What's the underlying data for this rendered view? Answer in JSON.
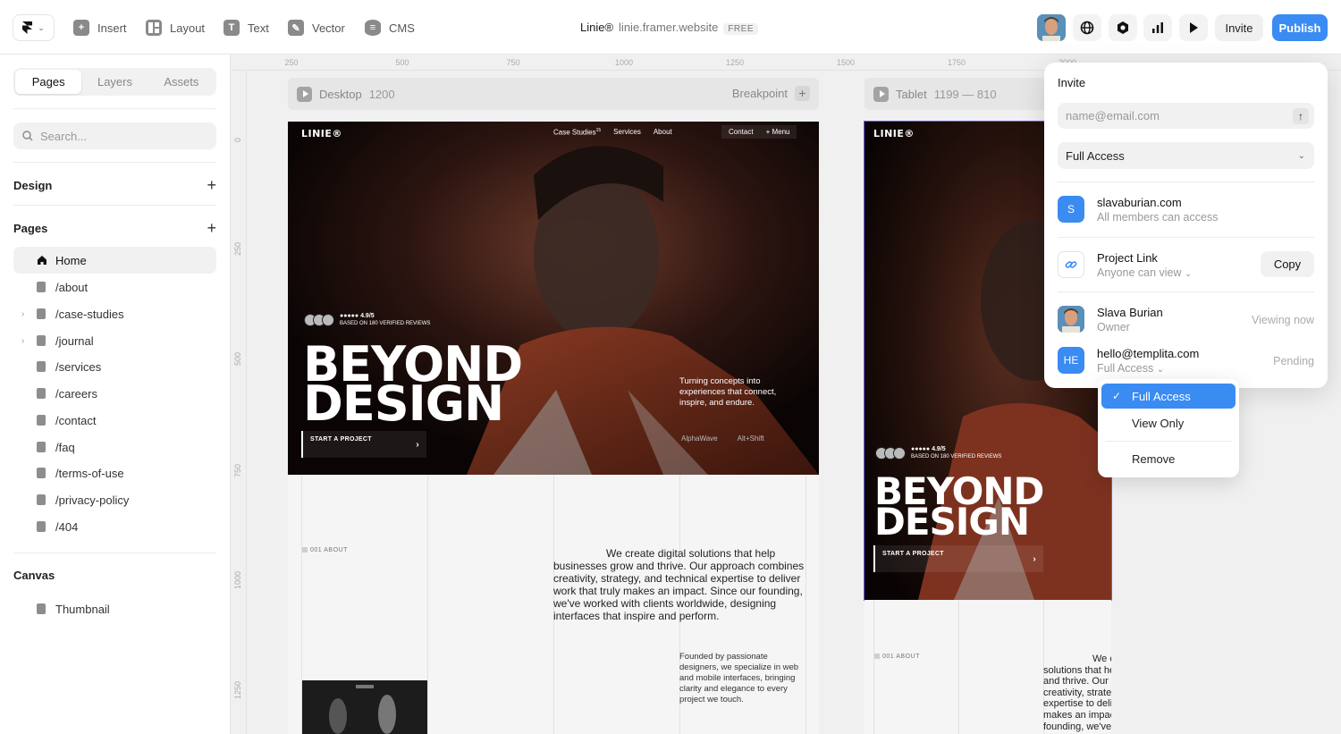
{
  "topbar": {
    "insert": "Insert",
    "layout": "Layout",
    "text": "Text",
    "vector": "Vector",
    "cms": "CMS",
    "project_name": "Linie®",
    "project_url": "linie.framer.website",
    "plan_badge": "FREE",
    "invite": "Invite",
    "publish": "Publish"
  },
  "sidebar": {
    "tabs": [
      "Pages",
      "Layers",
      "Assets"
    ],
    "search_placeholder": "Search...",
    "design_header": "Design",
    "pages_header": "Pages",
    "pages": [
      "Home",
      "/about",
      "/case-studies",
      "/journal",
      "/services",
      "/careers",
      "/contact",
      "/faq",
      "/terms-of-use",
      "/privacy-policy",
      "/404"
    ],
    "canvas_header": "Canvas",
    "canvas_items": [
      "Thumbnail"
    ]
  },
  "rulers": {
    "top": [
      "250",
      "500",
      "750",
      "1000",
      "1250",
      "1500",
      "1750",
      "2000"
    ],
    "left": [
      "0",
      "250",
      "500",
      "750",
      "1000",
      "1250"
    ]
  },
  "breakpoints": {
    "desktop": {
      "name": "Desktop",
      "width": "1200",
      "action": "Breakpoint"
    },
    "tablet": {
      "name": "Tablet",
      "range": "1199 — 810"
    }
  },
  "site": {
    "logo": "LINIE®",
    "nav": [
      "Case Studies",
      "Services",
      "About"
    ],
    "nav_sup": "15",
    "contact": "Contact",
    "menu": "+ Menu",
    "rating": "●●●●● 4.9/5",
    "reviews": "BASED ON 180 VERIFIED REVIEWS",
    "headline_1": "BEYOND",
    "headline_2": "DESIGN",
    "cta": "START A PROJECT",
    "tagline": "Turning concepts into experiences that connect, inspire, and endure.",
    "brands": [
      "AlphaWave",
      "Alt+Shift"
    ],
    "about_tag": "001   ABOUT",
    "about_text": "We create digital solutions that help businesses grow and thrive. Our approach combines creativity, strategy, and technical expertise to deliver work that truly makes an impact. Since our founding, we've worked with clients worldwide, designing interfaces that inspire and perform.",
    "about_small": "Founded by passionate designers, we specialize in web and mobile interfaces, bringing clarity and elegance to every project we touch.",
    "tablet_about_text": "We create digital solutions that help businesses grow and thrive. Our approach combines creativity, strategy, and technical expertise to deliver work that truly makes an impact. Since our founding, we've worked with clients"
  },
  "invite_popover": {
    "title": "Invite",
    "email_placeholder": "name@email.com",
    "access_select": "Full Access",
    "workspace": {
      "initial": "S",
      "name": "slavaburian.com",
      "desc": "All members can access"
    },
    "project_link": {
      "title": "Project Link",
      "desc": "Anyone can view",
      "copy": "Copy"
    },
    "members": [
      {
        "name": "Slava Burian",
        "role": "Owner",
        "status": "Viewing now"
      },
      {
        "initial": "HE",
        "name": "hello@templita.com",
        "role": "Full Access",
        "status": "Pending"
      }
    ]
  },
  "access_menu": {
    "options": [
      "Full Access",
      "View Only"
    ],
    "remove": "Remove",
    "selected": "Full Access"
  },
  "colors": {
    "accent": "#3a8bf2",
    "workspace_icon": "#3a8bf2",
    "member_icon": "#3a8bf2"
  }
}
